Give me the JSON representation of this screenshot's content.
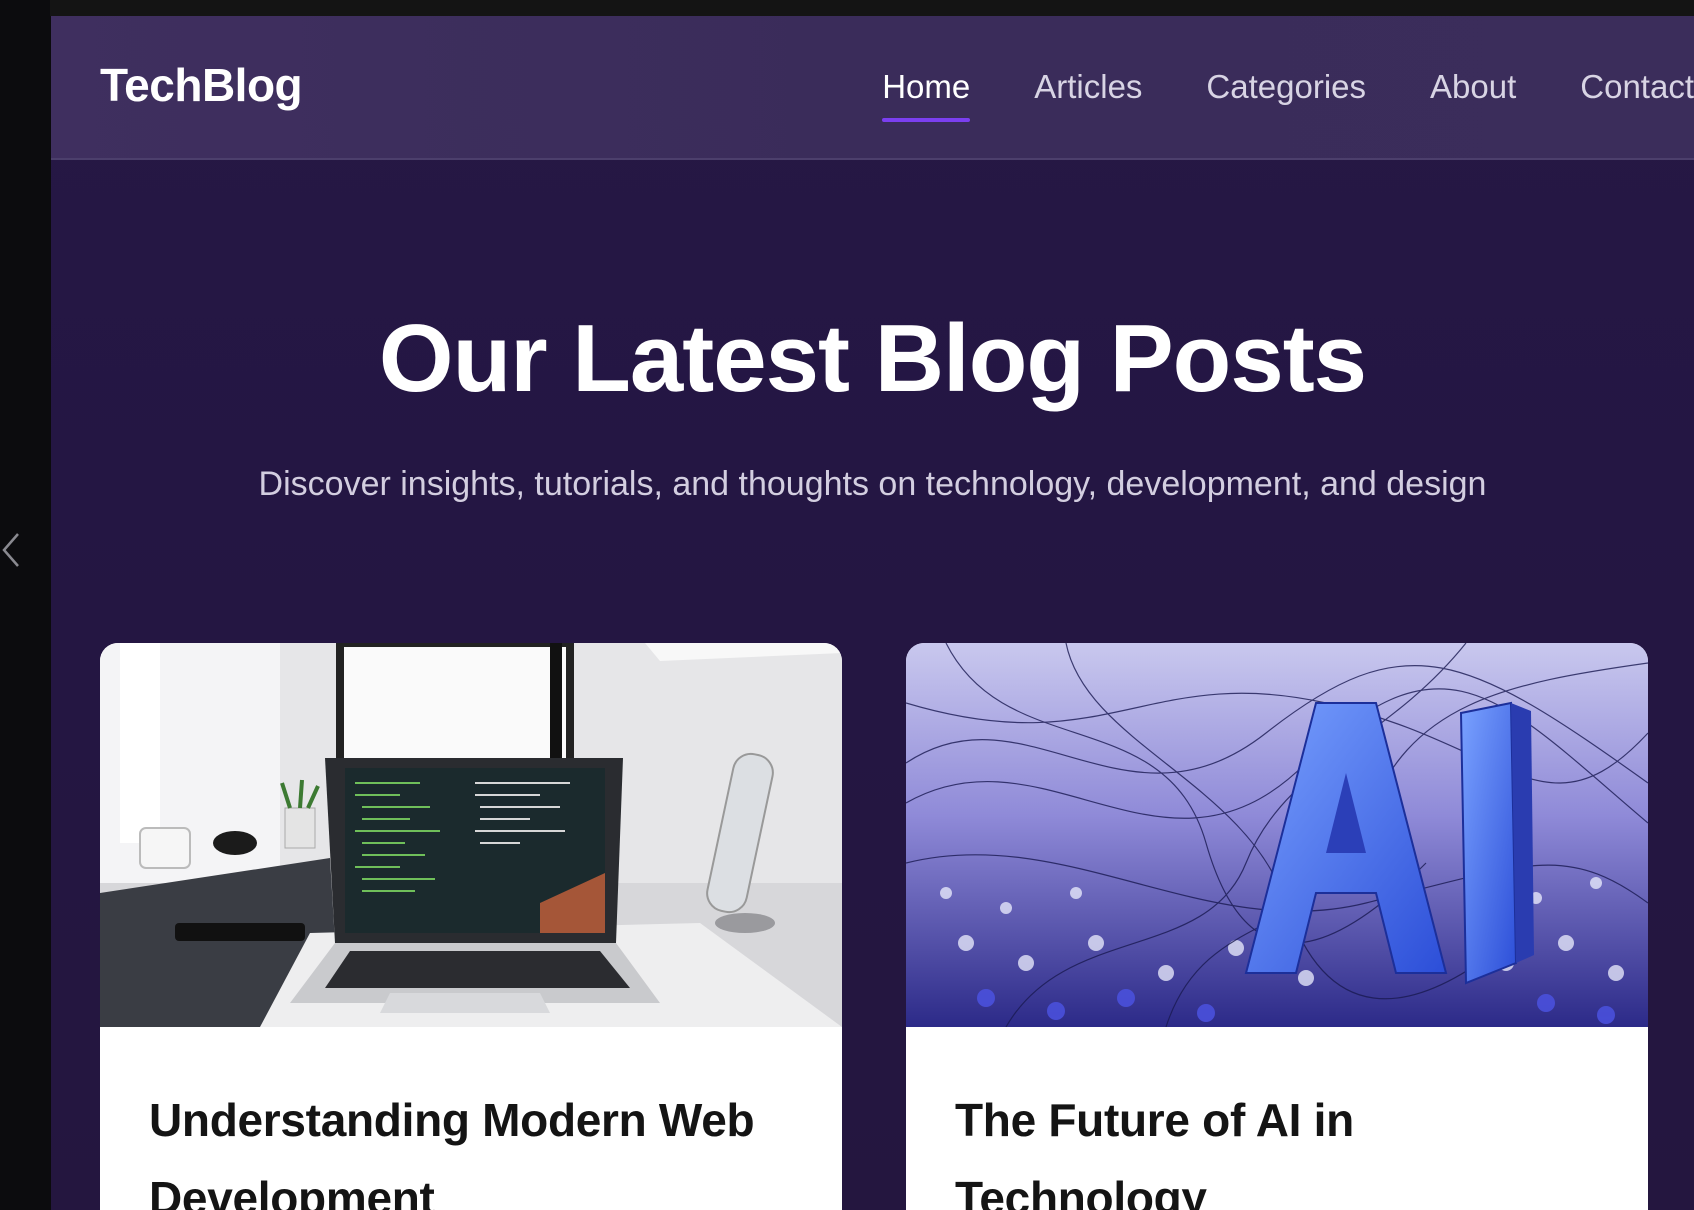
{
  "header": {
    "logo": "TechBlog",
    "nav": [
      {
        "label": "Home",
        "active": true
      },
      {
        "label": "Articles",
        "active": false
      },
      {
        "label": "Categories",
        "active": false
      },
      {
        "label": "About",
        "active": false
      },
      {
        "label": "Contact",
        "active": false
      }
    ]
  },
  "hero": {
    "title": "Our Latest Blog Posts",
    "subtitle": "Discover insights, tutorials, and thoughts on technology, development, and design"
  },
  "posts": [
    {
      "title": "Understanding Modern Web Development",
      "image": "laptop-desk-photo"
    },
    {
      "title": "The Future of AI in Technology",
      "image": "ai-3d-letters-art"
    }
  ],
  "colors": {
    "accent": "#7b3ff0",
    "background": "#251744",
    "navbar": "#3d2e5d"
  },
  "icons": {
    "back": "chevron-left-icon"
  }
}
